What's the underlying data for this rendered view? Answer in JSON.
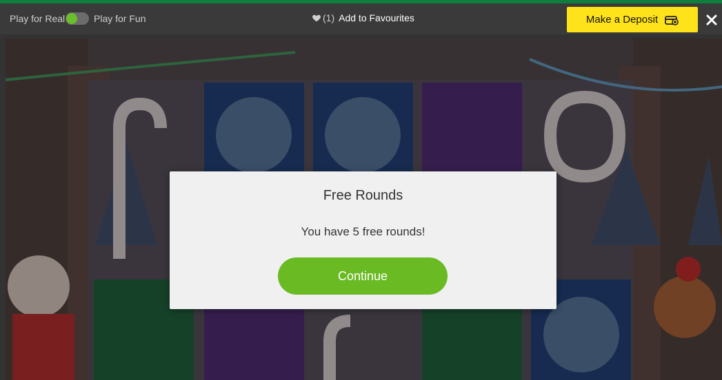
{
  "topbar": {
    "mode_real_label": "Play for Real",
    "mode_fun_label": "Play for Fun",
    "favourites_count": "(1)",
    "favourites_label": "Add to Favourites",
    "deposit_label": "Make a Deposit",
    "icons": {
      "heart": "heart-icon",
      "deposit": "deposit-icon",
      "close": "close-icon"
    }
  },
  "dialog": {
    "title": "Free Rounds",
    "message": "You have 5 free rounds!",
    "continue_label": "Continue"
  },
  "colors": {
    "deposit_button": "#ffe31a",
    "continue_button": "#6aba23",
    "toggle_knob": "#6bbf2a",
    "top_accent": "#0f7d3b"
  }
}
